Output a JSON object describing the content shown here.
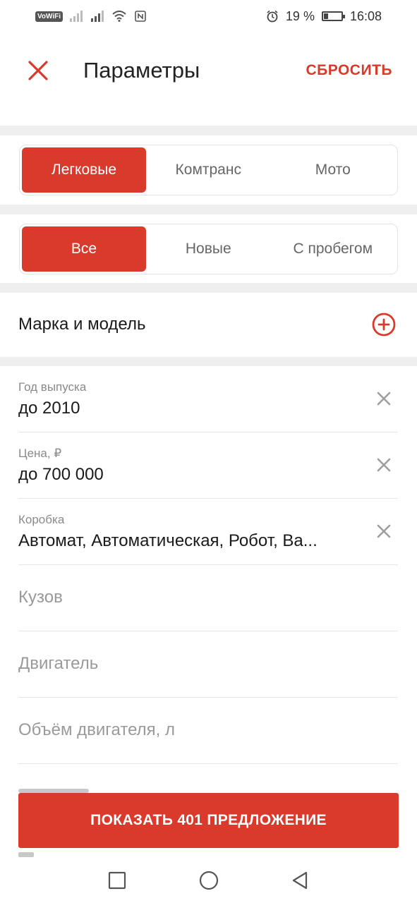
{
  "status_bar": {
    "volte": "VoWiFi",
    "battery": "19 %",
    "battery_level": 0.19,
    "time": "16:08",
    "icons": [
      "sim-signal-icon",
      "signal-icon",
      "wifi-icon",
      "nfc-icon",
      "alarm-icon",
      "battery-icon"
    ]
  },
  "header": {
    "title": "Параметры",
    "reset_label": "СБРОСИТЬ"
  },
  "vehicle_type": {
    "items": [
      "Легковые",
      "Комтранс",
      "Мото"
    ],
    "selected": "Легковые"
  },
  "condition": {
    "items": [
      "Все",
      "Новые",
      "С пробегом"
    ],
    "selected": "Все"
  },
  "brand_model": {
    "label": "Марка и модель"
  },
  "fields": {
    "year": {
      "label": "Год выпуска",
      "value": "до 2010"
    },
    "price": {
      "label": "Цена, ₽",
      "value": "до 700 000"
    },
    "gearbox": {
      "label": "Коробка",
      "value": "Автомат, Автоматическая, Робот, Ва..."
    },
    "body": {
      "placeholder": "Кузов"
    },
    "engine": {
      "placeholder": "Двигатель"
    },
    "volume": {
      "placeholder": "Объём двигателя, л"
    }
  },
  "cta": {
    "label": "ПОКАЗАТЬ 401 ПРЕДЛОЖЕНИЕ"
  },
  "colors": {
    "accent": "#d93a2b",
    "separator": "#efefef",
    "muted": "#8a8a8a"
  }
}
